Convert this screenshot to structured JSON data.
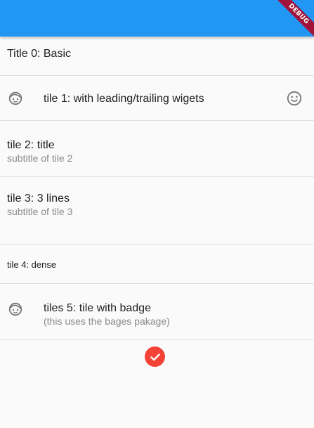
{
  "app_bar": {
    "color": "#2196f3",
    "debug_banner": "DEBUG"
  },
  "tiles": [
    {
      "title": "Title 0: Basic"
    },
    {
      "title": "tile 1: with leading/trailing wigets",
      "leading_icon": "face-icon",
      "trailing_icon": "smiley-icon"
    },
    {
      "title": "tile 2: title",
      "subtitle": "subtitle of tile 2"
    },
    {
      "title": "tile 3: 3 lines",
      "subtitle": "subtitle of tile 3"
    },
    {
      "title": "tile 4: dense"
    },
    {
      "title": "tiles 5: tile with badge",
      "subtitle": "(this uses the bages pakage)",
      "leading_icon": "face-icon"
    }
  ],
  "badge": {
    "icon": "check-icon",
    "color": "#f44336"
  }
}
